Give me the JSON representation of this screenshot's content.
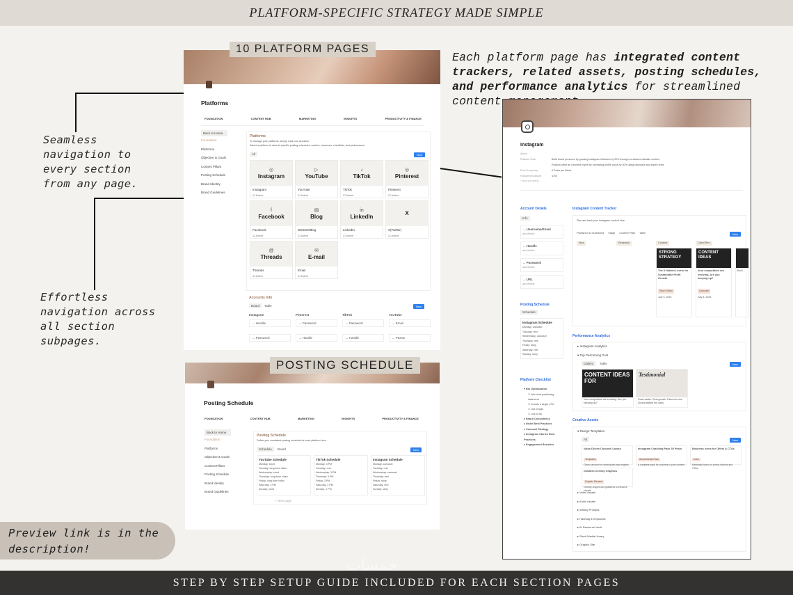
{
  "header": {
    "title": "PLATFORM-SPECIFIC STRATEGY MADE SIMPLE"
  },
  "footer": {
    "text": "STEP BY STEP SETUP GUIDE INCLUDED FOR EACH SECTION PAGES"
  },
  "callouts": {
    "seamless": [
      "Seamless",
      "navigation to",
      "every section",
      "from any page."
    ],
    "effortless": [
      "Effortless",
      "navigation across",
      "all section",
      "subpages."
    ],
    "preview": [
      "Preview link is in the",
      "description!"
    ]
  },
  "headline": {
    "p1": "Each platform page has ",
    "bold": "integrated content trackers, related assets, posting schedules, and performance analytics",
    "p2": " for streamlined content management."
  },
  "labels": {
    "platform_pages": "10 PLATFORM PAGES",
    "posting_schedule": "POSTING SCHEDULE"
  },
  "nav": [
    "FOUNDATION",
    "CONTENT HUB",
    "MARKETING",
    "INSIGHTS",
    "PRODUCTIVITY & FINANCE"
  ],
  "platforms_page": {
    "title": "Platforms",
    "back": "Back to Home",
    "sidebar_head": "Foundation",
    "sidebar": [
      "Platforms",
      "Objective & Goals",
      "Content Pillars",
      "Posting Schedule",
      "Brand Identity",
      "Brand Guidelines"
    ],
    "db_title": "Platforms",
    "desc1": "To manage your platforms, simply mark one as Active.",
    "desc2": "Select a platform to view its specific posting schedules, content, resources, checklists, and performance.",
    "view": "All",
    "new": "New",
    "cards": [
      {
        "icon": "◎",
        "name": "Instagram",
        "caption": "Instagram",
        "status": "Active"
      },
      {
        "icon": "▷",
        "name": "YouTube",
        "caption": "YouTube",
        "status": "Active"
      },
      {
        "icon": "♪",
        "name": "TikTok",
        "caption": "TikTok",
        "status": "Active"
      },
      {
        "icon": "◎",
        "name": "Pinterest",
        "caption": "Pinterest",
        "status": "Active"
      },
      {
        "icon": "f",
        "name": "Facebook",
        "caption": "Facebook",
        "status": "Active"
      },
      {
        "icon": "▤",
        "name": "Blog",
        "caption": "Website/Blog",
        "status": "Active"
      },
      {
        "icon": "in",
        "name": "LinkedIn",
        "caption": "LinkedIn",
        "status": "Active"
      },
      {
        "icon": "",
        "name": "X",
        "caption": "X(Twitter)",
        "status": "Active"
      },
      {
        "icon": "@",
        "name": "Threads",
        "caption": "Threads",
        "status": "Active"
      },
      {
        "icon": "✉",
        "name": "E-mail",
        "caption": "Email",
        "status": "Active"
      }
    ],
    "new_page": "+ New page",
    "accounts": {
      "title": "Accounts Info",
      "tabs": [
        "Board",
        "Table"
      ],
      "columns": [
        "Instagram",
        "Pinterest",
        "TikTok",
        "YouTube"
      ],
      "row1": [
        "Handle",
        "Password",
        "Password",
        "Email"
      ],
      "row2": [
        "Password",
        "Handle",
        "Handle",
        "Passw"
      ]
    }
  },
  "posting_page": {
    "title": "Posting Schedule",
    "back": "Back to Home",
    "sidebar_head": "Foundation",
    "sidebar": [
      "Platforms",
      "Objective & Goals",
      "Content Pillars",
      "Posting Schedule",
      "Brand Identity",
      "Brand Guidelines"
    ],
    "db_title": "Posting Schedule",
    "desc": "Define your consistent posting schedule for each platform here.",
    "tabs": [
      "Schedule",
      "Board"
    ],
    "new": "New",
    "columns": [
      {
        "title": "YouTube Schedule",
        "rows": [
          "Monday: short",
          "Tuesday: long-form video",
          "Wednesday: short",
          "Thursday: long-form video",
          "Friday: long-form video",
          "Saturday: 3 PM",
          "Sunday: short"
        ]
      },
      {
        "title": "TikTok Schedule",
        "rows": [
          "Monday: 3 PM",
          "Tuesday: reel",
          "Wednesday: 3 PM",
          "Thursday: 5 PM",
          "Friday: 3 PM",
          "Saturday: 2 PM",
          "Sunday: 1 PM"
        ]
      },
      {
        "title": "Instagram Schedule",
        "rows": [
          "Monday: carousel",
          "Tuesday: reel",
          "Wednesday: carousel",
          "Thursday: reel",
          "Friday: story",
          "Saturday: reel",
          "Sunday: story"
        ]
      }
    ],
    "new_page": "+ New page"
  },
  "instagram_page": {
    "title": "Instagram",
    "props": [
      {
        "k": "Active",
        "v": ""
      },
      {
        "k": "Platform Goal",
        "v": "Build brand presence by growing Instagram followers by 20% through consistent valuable content"
      },
      {
        "k": "",
        "v": "Position client as a trusted expert by increasing profile clicks by 30% using carousels and expert reels"
      },
      {
        "k": "Post Frequency",
        "v": "5 Posts per Week"
      },
      {
        "k": "Followers/Subscrib",
        "v": "4700"
      }
    ],
    "add_property": "+ Add a property",
    "account_details": "Account Details",
    "info_view": "Info",
    "account_items": [
      "Username/Email",
      "Handle",
      "Password",
      "URL"
    ],
    "add_details": "add details",
    "posting_schedule": "Posting Schedule",
    "schedule_view": "Schedule",
    "schedule_card": "Instagram Schedule",
    "schedule_rows": [
      "Monday: carousel",
      "Tuesday: reel",
      "Wednesday: carousel",
      "Thursday: reel",
      "Friday: story",
      "Saturday: reel",
      "Sunday: story"
    ],
    "checklist": "Platform Checklist",
    "checklist_items": [
      "Bio Optimization",
      "Brand Consistency",
      "Niche Best Practices",
      "Carousel Strategy",
      "Instagram Stories Best Practices",
      "Engagement Boosters"
    ],
    "bio_items": [
      "Add clear positioning statement",
      "Include a single CTA",
      "Use emojis",
      "Link in bio"
    ],
    "tracker": {
      "title": "Instagram Content Tracker",
      "hint": "Plan and track your Instagram content here",
      "views": [
        "Published & Scheduled",
        "Stage",
        "Content Pillar",
        "Table"
      ],
      "new": "New",
      "columns": [
        "Idea",
        "Research",
        "Content",
        "Client Rev"
      ],
      "cards": [
        {
          "img": "STRONG STRATEGY",
          "title": "The 5 Hidden Levers for Sustainable Profit Growth",
          "tag": "Short Video",
          "date": "July 3, 2025"
        },
        {
          "img": "CONTENT IDEAS",
          "title": "Your competitors are evolving. Are you keeping up?",
          "tag": "Carousel",
          "date": "July 4, 2025"
        },
        {
          "img": "",
          "title": "Short...",
          "tag": "",
          "date": ""
        }
      ]
    },
    "analytics": {
      "title": "Performance Analytics",
      "items": [
        "Instagram Analytics",
        "Top Performing Post"
      ],
      "tabs": [
        "Gallery",
        "Table"
      ],
      "posts": [
        {
          "img": "CONTENT IDEAS FOR",
          "caption": "Your competitors are evolving. Are you keeping up?"
        },
        {
          "img": "Testimonial",
          "caption": "Real results. Real growth. Discover how Donna shifted the odds."
        }
      ]
    },
    "assets": {
      "title": "Creative Assets",
      "design": "Design Templates",
      "view": "All",
      "cards": [
        {
          "title": "Value-Driven Carousel Layout",
          "tag": "Templates",
          "desc": "Clean carousel for sharing tips and insights."
        },
        {
          "title": "Instagram Coaching Pack 30 Posts",
          "tag": "Social Media Pack",
          "desc": "A complete pack for coaches to post content."
        },
        {
          "title": "Business Icons for Offers & CTAs",
          "tag": "Icons",
          "desc": "Minimalist icons for promo buttons and CTAs."
        },
        {
          "title": "Gradient Overlay Graphics",
          "tag": "Graphic Element",
          "desc": "Overlay shapes and gradients to enhance visuals."
        }
      ],
      "others": [
        "Video Assets",
        "Audio Assets",
        "Writing Prompts",
        "Hashtag & Keywords",
        "AI Resource Vault",
        "Stock Media Library",
        "Graphic Site"
      ]
    }
  },
  "watermark": "خمسات"
}
